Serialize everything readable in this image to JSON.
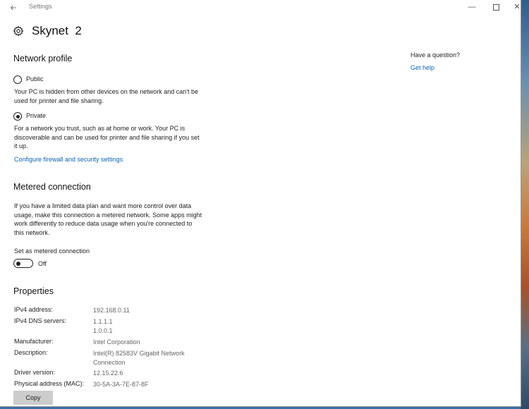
{
  "titlebar": {
    "back_icon": "back-arrow-icon",
    "app_title": "Settings",
    "minimize_glyph": "—",
    "close_glyph": "✕"
  },
  "header": {
    "gear_icon": "gear-icon",
    "title": "Skynet  2"
  },
  "network_profile": {
    "heading": "Network profile",
    "public_label": "Public",
    "public_selected": false,
    "public_desc_line1": "Your PC is hidden from other devices on the network and can't be",
    "public_desc_line2": "used for printer and file sharing.",
    "private_label": "Private",
    "private_selected": true,
    "private_desc_line1": "For a network you trust, such as at home or work. Your PC is",
    "private_desc_line2": "discoverable and can be used for printer and file sharing if you set",
    "private_desc_line3": "it up.",
    "firewall_link": "Configure firewall and security settings"
  },
  "metered": {
    "heading": "Metered connection",
    "desc_line1": "If you have a limited data plan and want more control over data",
    "desc_line2": "usage, make this connection a metered network. Some apps might",
    "desc_line3": "work differently to reduce data usage when you're connected to",
    "desc_line4": "this network.",
    "toggle_label": "Set as metered connection",
    "toggle_state": "Off",
    "toggle_on": false
  },
  "properties": {
    "heading": "Properties",
    "ipv4_label": "IPv4 address:",
    "ipv4_value": "192.168.0.11",
    "dns_label": "IPv4 DNS servers:",
    "dns_value1": "1.1.1.1",
    "dns_value2": "1.0.0.1",
    "manufacturer_label": "Manufacturer:",
    "manufacturer_value": "Intel Corporation",
    "description_label": "Description:",
    "description_value1": "Intel(R) 82583V Gigabit Network",
    "description_value2": "Connection",
    "driver_label": "Driver version:",
    "driver_value": "12.15.22.6",
    "mac_label": "Physical address (MAC):",
    "mac_value": "30-5A-3A-7E-87-8F",
    "copy_button": "Copy"
  },
  "aside": {
    "question": "Have a question?",
    "help_link": "Get help"
  },
  "colors": {
    "link": "#0a64b5",
    "button_bg": "#cccccc"
  }
}
